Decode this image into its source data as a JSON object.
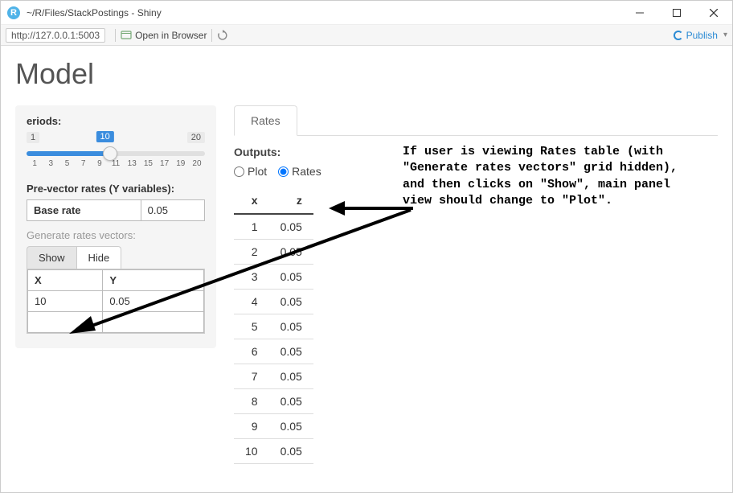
{
  "window": {
    "title": "~/R/Files/StackPostings - Shiny",
    "app_icon_letter": "R"
  },
  "toolbar": {
    "url": "http://127.0.0.1:5003",
    "open_in_browser": "Open in Browser",
    "publish": "Publish"
  },
  "page": {
    "title": "Model"
  },
  "sidebar": {
    "periods_label": "eriods:",
    "slider": {
      "min": "1",
      "max": "20",
      "value": "10",
      "ticks": [
        "1",
        "3",
        "5",
        "7",
        "9",
        "11",
        "13",
        "15",
        "17",
        "19",
        "20"
      ]
    },
    "prevector_label": "Pre-vector rates (Y variables):",
    "prevector_table": {
      "label": "Base rate",
      "value": "0.05"
    },
    "generate_label": "Generate rates vectors:",
    "show_label": "Show",
    "hide_label": "Hide",
    "xy_table": {
      "headers": [
        "X",
        "Y"
      ],
      "rows": [
        {
          "x": "10",
          "y": "0.05"
        },
        {
          "x": "",
          "y": ""
        }
      ]
    }
  },
  "main": {
    "tab_label": "Rates",
    "outputs_label": "Outputs:",
    "radio_plot": "Plot",
    "radio_rates": "Rates",
    "table": {
      "headers": [
        "x",
        "z"
      ],
      "rows": [
        {
          "x": "1",
          "z": "0.05"
        },
        {
          "x": "2",
          "z": "0.05"
        },
        {
          "x": "3",
          "z": "0.05"
        },
        {
          "x": "4",
          "z": "0.05"
        },
        {
          "x": "5",
          "z": "0.05"
        },
        {
          "x": "6",
          "z": "0.05"
        },
        {
          "x": "7",
          "z": "0.05"
        },
        {
          "x": "8",
          "z": "0.05"
        },
        {
          "x": "9",
          "z": "0.05"
        },
        {
          "x": "10",
          "z": "0.05"
        }
      ]
    }
  },
  "annotation": {
    "text": "If user is viewing Rates table (with \"Generate rates vectors\" grid hidden), and then clicks on \"Show\", main panel view should change to \"Plot\"."
  }
}
